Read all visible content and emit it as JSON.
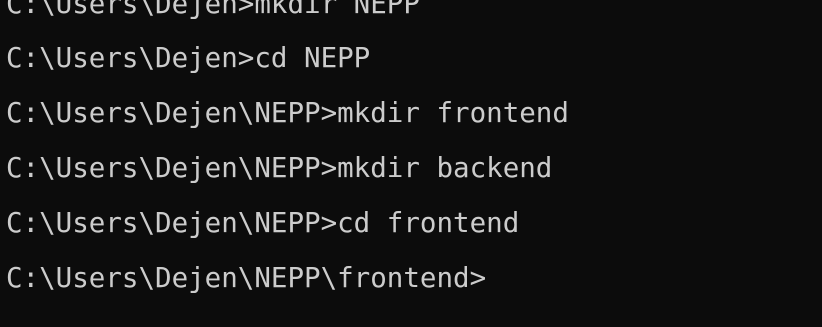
{
  "terminal": {
    "lines": [
      "C:\\Users\\Dejen>mkdir NEPP",
      "C:\\Users\\Dejen>cd NEPP",
      "C:\\Users\\Dejen\\NEPP>mkdir frontend",
      "C:\\Users\\Dejen\\NEPP>mkdir backend",
      "C:\\Users\\Dejen\\NEPP>cd frontend",
      "C:\\Users\\Dejen\\NEPP\\frontend>"
    ],
    "colors": {
      "background": "#0c0c0c",
      "text": "#cccccc"
    }
  }
}
